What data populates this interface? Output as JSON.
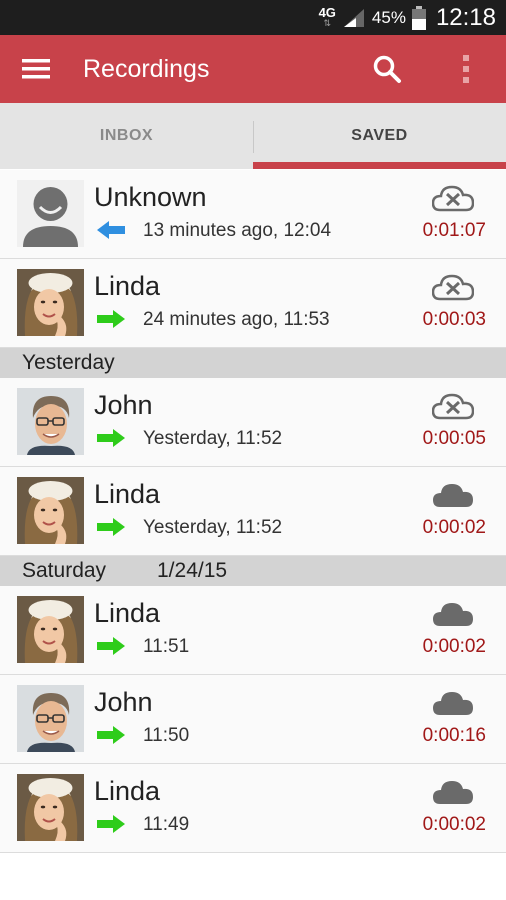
{
  "status_bar": {
    "network": "4G",
    "battery": "45%",
    "time": "12:18"
  },
  "app_bar": {
    "title": "Recordings"
  },
  "tabs": [
    {
      "label": "INBOX"
    },
    {
      "label": "SAVED"
    }
  ],
  "colors": {
    "accent": "#c8424a",
    "duration": "#a01818",
    "incoming_arrow": "#2f8fe0",
    "outgoing_arrow": "#2ecc1a"
  },
  "groups": [
    {
      "header": null,
      "items": [
        {
          "name": "Unknown",
          "time": "13 minutes ago, 12:04",
          "duration": "0:01:07",
          "avatar": "default-avatar",
          "direction": "incoming",
          "cloud": "cloud-not-synced-icon"
        },
        {
          "name": "Linda",
          "time": "24 minutes ago, 11:53",
          "duration": "0:00:03",
          "avatar": "linda",
          "direction": "outgoing",
          "cloud": "cloud-not-synced-icon"
        }
      ]
    },
    {
      "header": {
        "label": "Yesterday",
        "date": ""
      },
      "items": [
        {
          "name": "John",
          "time": "Yesterday, 11:52",
          "duration": "0:00:05",
          "avatar": "john",
          "direction": "outgoing",
          "cloud": "cloud-not-synced-icon"
        },
        {
          "name": "Linda",
          "time": "Yesterday, 11:52",
          "duration": "0:00:02",
          "avatar": "linda",
          "direction": "outgoing",
          "cloud": "cloud-synced-icon"
        }
      ]
    },
    {
      "header": {
        "label": "Saturday",
        "date": "1/24/15"
      },
      "items": [
        {
          "name": "Linda",
          "time": "11:51",
          "duration": "0:00:02",
          "avatar": "linda",
          "direction": "outgoing",
          "cloud": "cloud-synced-icon"
        },
        {
          "name": "John",
          "time": "11:50",
          "duration": "0:00:16",
          "avatar": "john",
          "direction": "outgoing",
          "cloud": "cloud-synced-icon"
        },
        {
          "name": "Linda",
          "time": "11:49",
          "duration": "0:00:02",
          "avatar": "linda",
          "direction": "outgoing",
          "cloud": "cloud-synced-icon"
        }
      ]
    }
  ]
}
